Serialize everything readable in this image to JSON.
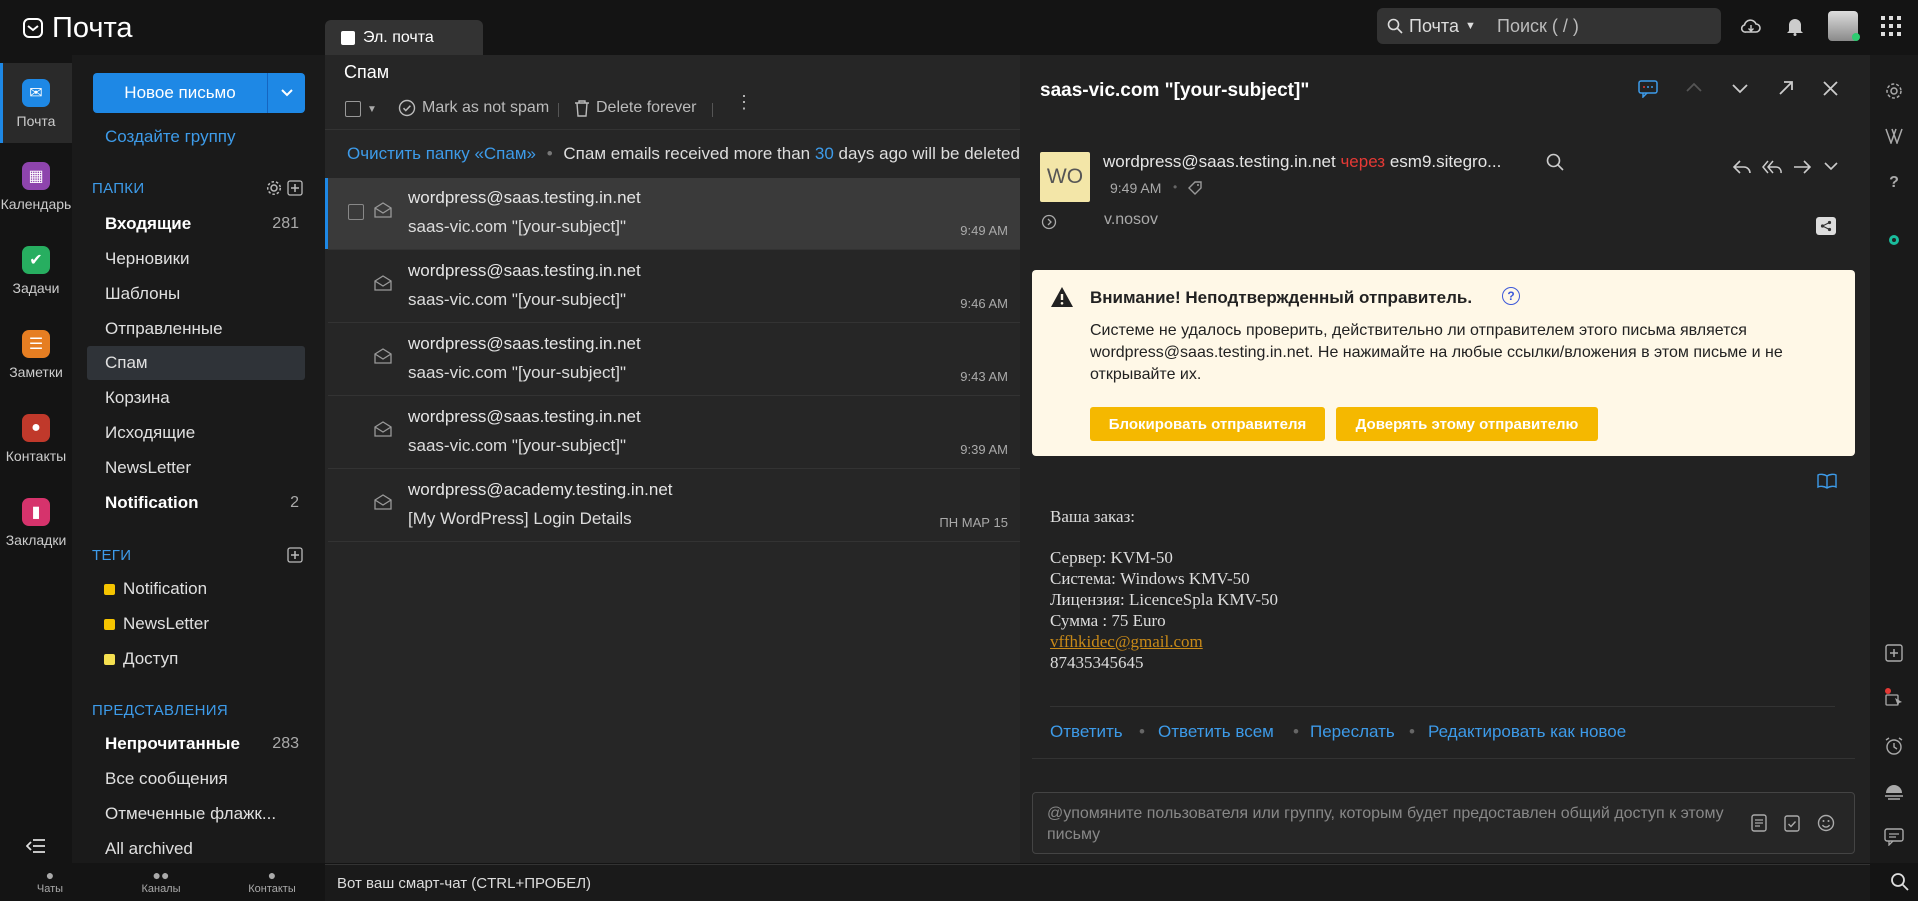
{
  "app": {
    "title": "Почта"
  },
  "search": {
    "scope": "Почта",
    "placeholder": "Поиск ( / )"
  },
  "rail": [
    {
      "label": "Почта",
      "color": "#1e88e5"
    },
    {
      "label": "Календарь",
      "color": "#8e44ad"
    },
    {
      "label": "Задачи",
      "color": "#27ae60"
    },
    {
      "label": "Заметки",
      "color": "#e67e22"
    },
    {
      "label": "Контакты",
      "color": "#c0392b"
    },
    {
      "label": "Закладки",
      "color": "#d6336c"
    }
  ],
  "sidebar": {
    "new_mail": "Новое письмо",
    "create_group": "Создайте группу",
    "folders_header": "ПАПКИ",
    "folders": [
      {
        "label": "Входящие",
        "count": "281"
      },
      {
        "label": "Черновики",
        "count": ""
      },
      {
        "label": "Шаблоны",
        "count": ""
      },
      {
        "label": "Отправленные",
        "count": ""
      },
      {
        "label": "Спам",
        "count": ""
      },
      {
        "label": "Корзина",
        "count": ""
      },
      {
        "label": "Исходящие",
        "count": ""
      },
      {
        "label": "NewsLetter",
        "count": ""
      },
      {
        "label": "Notification",
        "count": "2"
      }
    ],
    "tags_header": "ТЕГИ",
    "tags": [
      {
        "label": "Notification",
        "color": "#f5c400"
      },
      {
        "label": "NewsLetter",
        "color": "#f5c400"
      },
      {
        "label": "Доступ",
        "color": "#f5e050"
      }
    ],
    "views_header": "ПРЕДСТАВЛЕНИЯ",
    "views": [
      {
        "label": "Непрочитанные",
        "count": "283"
      },
      {
        "label": "Все сообщения",
        "count": ""
      },
      {
        "label": "Отмеченные флажк...",
        "count": ""
      },
      {
        "label": "All archived",
        "count": ""
      }
    ]
  },
  "bottom": {
    "chats": "Чаты",
    "channels": "Каналы",
    "contacts": "Контакты",
    "smart_chat": "Вот ваш смарт-чат (CTRL+ПРОБЕЛ)"
  },
  "list": {
    "tab": "Эл. почта",
    "folder_title": "Спам",
    "mark_not_spam": "Mark as not spam",
    "delete_forever": "Delete forever",
    "clean_folder": "Очистить папку «Спам»",
    "notice_prefix": "Спам emails received more than",
    "notice_days": "30",
    "notice_suffix": "days ago will be deleted",
    "messages": [
      {
        "from": "wordpress@saas.testing.in.net",
        "subject": "saas-vic.com \"[your-subject]\"",
        "time": "9:49 AM"
      },
      {
        "from": "wordpress@saas.testing.in.net",
        "subject": "saas-vic.com \"[your-subject]\"",
        "time": "9:46 AM"
      },
      {
        "from": "wordpress@saas.testing.in.net",
        "subject": "saas-vic.com \"[your-subject]\"",
        "time": "9:43 AM"
      },
      {
        "from": "wordpress@saas.testing.in.net",
        "subject": "saas-vic.com \"[your-subject]\"",
        "time": "9:39 AM"
      },
      {
        "from": "wordpress@academy.testing.in.net",
        "subject": "[My WordPress] Login Details",
        "time": "ПН МАР 15"
      }
    ]
  },
  "reader": {
    "subject": "saas-vic.com \"[your-subject]\"",
    "avatar": "WO",
    "sender": "wordpress@saas.testing.in.net",
    "via": "через",
    "via_host": "esm9.sitegro...",
    "time": "9:49 AM",
    "to": "v.nosov",
    "warning_title": "Внимание! Неподтвержденный отправитель.",
    "warning_text": "Системе не удалось проверить, действительно ли отправителем этого письма является wordpress@saas.testing.in.net. Не нажимайте на любые ссылки/вложения в этом письме и не открывайте их.",
    "block_btn": "Блокировать отправителя",
    "trust_btn": "Доверять этому отправителю",
    "body": [
      "Ваша заказ:",
      "Сервер: KVM-50",
      "Система: Windows KMV-50",
      "Лицензия: LicenceSpla KMV-50",
      "Сумма : 75 Euro",
      "vffhkidec@gmail.com",
      "87435345645"
    ],
    "reply": "Ответить",
    "reply_all": "Ответить всем",
    "forward": "Переслать",
    "edit_new": "Редактировать как новое",
    "comment_placeholder": "@упомяните пользователя или группу, которым будет предоставлен общий доступ к этому письму"
  }
}
